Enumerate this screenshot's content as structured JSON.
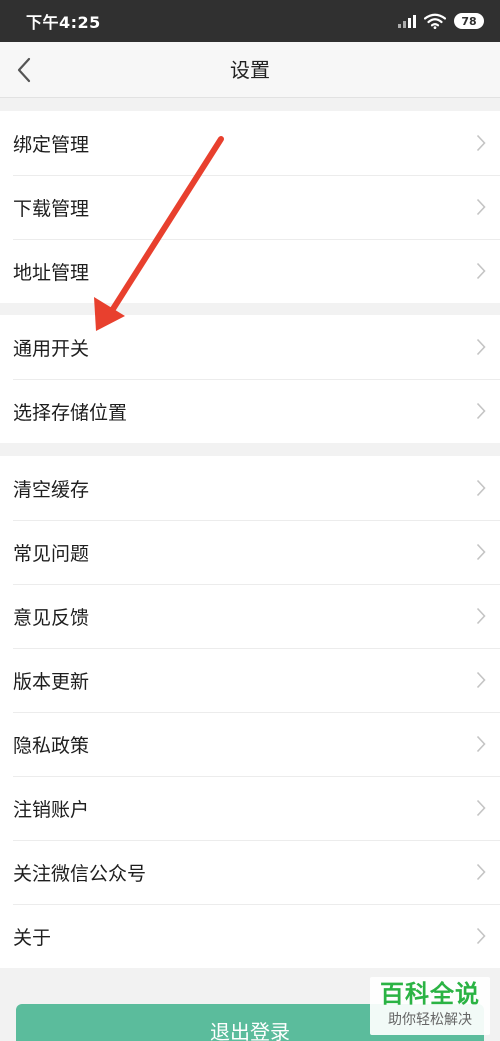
{
  "status_bar": {
    "time": "下午4:25",
    "battery": "78",
    "icons": [
      "signal-icon",
      "wifi-icon",
      "battery-icon"
    ]
  },
  "nav": {
    "title": "设置",
    "back_icon": "back-chevron-icon"
  },
  "groups": [
    {
      "items": [
        "绑定管理",
        "下载管理",
        "地址管理"
      ]
    },
    {
      "items": [
        "通用开关",
        "选择存储位置"
      ]
    },
    {
      "items": [
        "清空缓存",
        "常见问题",
        "意见反馈",
        "版本更新",
        "隐私政策",
        "注销账户",
        "关注微信公众号",
        "关于"
      ]
    }
  ],
  "logout": {
    "label": "退出登录"
  },
  "watermark": {
    "title": "百科全说",
    "subtitle": "助你轻松解决"
  },
  "colors": {
    "status_bar": "#303030",
    "nav_bar": "#f7f7f7",
    "background": "#f2f2f2",
    "logout_button": "#5bbc9c",
    "annotation_arrow": "#e8402e",
    "watermark_green": "#2bb344"
  }
}
